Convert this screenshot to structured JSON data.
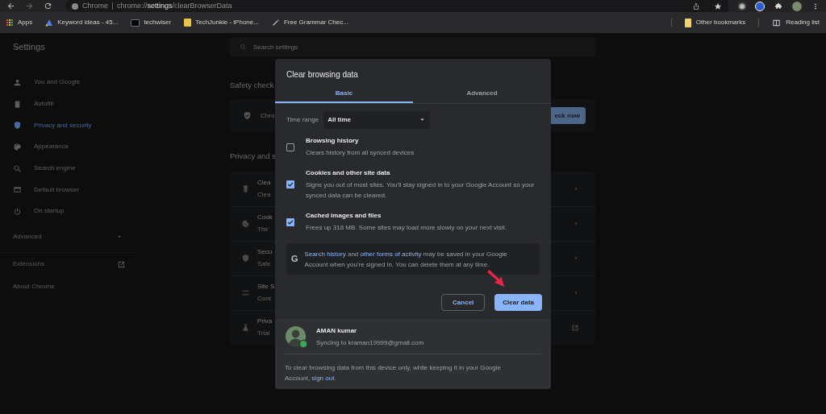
{
  "toolbar": {
    "omnibox": {
      "site": "Chrome",
      "scheme": "chrome://",
      "host": "settings",
      "path": "/clearBrowserData"
    }
  },
  "bookmarks": {
    "left": [
      {
        "label": "Apps",
        "kind": "apps"
      },
      {
        "label": "Keyword ideas - 45...",
        "kind": "ads"
      },
      {
        "label": "techwiser",
        "kind": "th"
      },
      {
        "label": "TechJunkie - iPhone...",
        "kind": "tj"
      },
      {
        "label": "Free Grammar Chec...",
        "kind": "pen"
      }
    ],
    "right": [
      {
        "label": "Other bookmarks",
        "kind": "folder"
      },
      {
        "label": "Reading list",
        "kind": "reading"
      }
    ]
  },
  "settings_header": {
    "title": "Settings",
    "search_placeholder": "Search settings"
  },
  "sidebar": {
    "items": [
      {
        "label": "You and Google",
        "selected": false
      },
      {
        "label": "Autofill",
        "selected": false
      },
      {
        "label": "Privacy and security",
        "selected": true
      },
      {
        "label": "Appearance",
        "selected": false
      },
      {
        "label": "Search engine",
        "selected": false
      },
      {
        "label": "Default browser",
        "selected": false
      },
      {
        "label": "On startup",
        "selected": false
      }
    ],
    "advanced": "Advanced",
    "links": [
      {
        "label": "Extensions",
        "kind": "external"
      },
      {
        "label": "About Chrome",
        "kind": "plain"
      }
    ]
  },
  "main": {
    "safety_check": {
      "heading": "Safety check",
      "row_title": "Chro",
      "button": "eck now"
    },
    "privacy": {
      "heading": "Privacy and s",
      "rows": [
        {
          "title": "Clea",
          "subtitle": "Clea",
          "kind": "chevron"
        },
        {
          "title": "Cook",
          "subtitle": "Thir",
          "kind": "chevron"
        },
        {
          "title": "Secu",
          "subtitle": "Safe",
          "kind": "chevron"
        },
        {
          "title": "Site S",
          "subtitle": "Cont",
          "kind": "chevron"
        },
        {
          "title": "Priva",
          "subtitle": "Trial",
          "kind": "external"
        }
      ]
    }
  },
  "dialog": {
    "title": "Clear browsing data",
    "tabs": [
      {
        "label": "Basic",
        "selected": true
      },
      {
        "label": "Advanced",
        "selected": false
      }
    ],
    "time_range": {
      "label": "Time range",
      "value": "All time"
    },
    "options": [
      {
        "title": "Browsing history",
        "description": "Clears history from all synced devices",
        "checked": false
      },
      {
        "title": "Cookies and other site data",
        "description": "Signs you out of most sites. You'll stay signed in to your Google Account so your synced data can be cleared.",
        "checked": true
      },
      {
        "title": "Cached images and files",
        "description": "Frees up 318 MB. Some sites may load more slowly on your next visit.",
        "checked": true
      }
    ],
    "note_badge": "G",
    "note": [
      {
        "text": "Search history",
        "link": true
      },
      {
        "text": " and ",
        "link": false
      },
      {
        "text": "other forms of activity",
        "link": true
      },
      {
        "text": " may be saved in your Google Account when you're signed in. You can delete them at any time.",
        "link": false
      }
    ],
    "buttons": {
      "cancel": "Cancel",
      "confirm": "Clear data"
    },
    "account": {
      "name": "AMAN kumar",
      "status": "Syncing to kraman19999@gmail.com"
    },
    "footer": [
      {
        "text": "To clear browsing data from this device only, while keeping it in your Google Account, ",
        "link": false
      },
      {
        "text": "sign out",
        "link": true
      },
      {
        "text": ".",
        "link": false
      }
    ]
  }
}
